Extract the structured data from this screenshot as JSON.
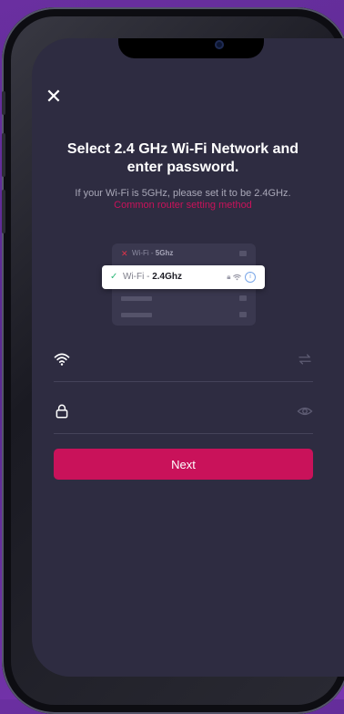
{
  "header": {
    "close_icon": "close-icon"
  },
  "main": {
    "title": "Select 2.4 GHz Wi-Fi Network and enter password.",
    "hint": "If your Wi-Fi is 5GHz, please set it to be 2.4GHz.",
    "router_link": "Common router setting method"
  },
  "illustration": {
    "wifi_prefix": "Wi-Fi - ",
    "network_5g": "5Ghz",
    "network_24g": "2.4Ghz"
  },
  "form": {
    "wifi_field": {
      "value": "",
      "placeholder": "",
      "icon": "wifi-icon",
      "action_icon": "switch-network-icon"
    },
    "password_field": {
      "value": "",
      "placeholder": "",
      "icon": "lock-icon",
      "action_icon": "eye-icon"
    },
    "next_label": "Next"
  },
  "colors": {
    "background": "#2e2c41",
    "accent": "#c9125a",
    "text_primary": "#ffffff",
    "text_secondary": "#a9a8b8",
    "success": "#2eb87a",
    "error": "#e0334a"
  }
}
